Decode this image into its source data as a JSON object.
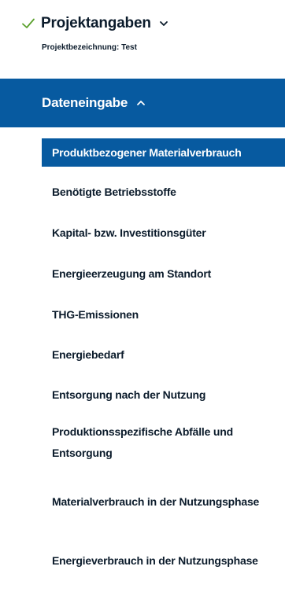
{
  "project_section": {
    "title": "Projektangaben",
    "expanded": false,
    "completed": true,
    "project_name_line": "Projektbezeichnung: Test"
  },
  "data_section": {
    "title": "Dateneingabe",
    "expanded": true
  },
  "menu": {
    "items": [
      {
        "label": "Produktbezogener Materialverbrauch",
        "active": true
      },
      {
        "label": "Benötigte Betriebsstoffe",
        "active": false
      },
      {
        "label": "Kapital- bzw. Investitionsgüter",
        "active": false
      },
      {
        "label": "Energieerzeugung am Standort",
        "active": false
      },
      {
        "label": "THG-Emissionen",
        "active": false
      },
      {
        "label": "Energiebedarf",
        "active": false
      },
      {
        "label": "Entsorgung nach der Nutzung",
        "active": false
      },
      {
        "label": "Produktionsspezifische Abfälle und Entsorgung",
        "active": false
      },
      {
        "label": "Materialverbrauch in der Nutzungsphase",
        "active": false
      },
      {
        "label": "Energieverbrauch in der Nutzungsphase",
        "active": false
      }
    ]
  },
  "colors": {
    "accent": "#075aa0",
    "text": "#0b1b2b",
    "check": "#5aa02c",
    "header_text": "#ffffff"
  },
  "icons": {
    "check": "check-icon",
    "chevron_down": "chevron-down-icon",
    "chevron_up": "chevron-up-icon"
  }
}
